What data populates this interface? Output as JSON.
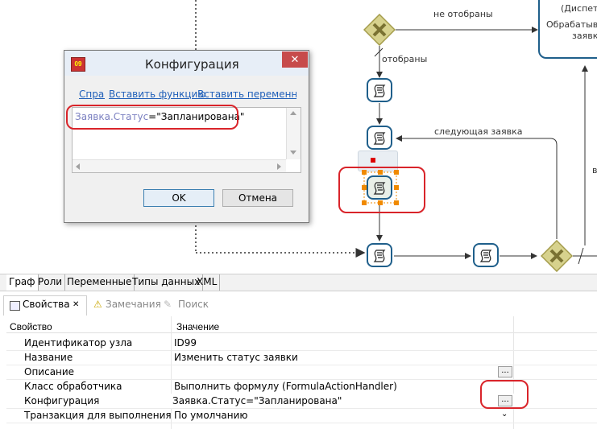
{
  "canvas": {
    "labels": {
      "not_selected": "не отобраны",
      "selected": "отобраны",
      "next_request": "следующая заявка",
      "dispatcher_partial": "(Диспет",
      "process_partial": "Обрабатыв",
      "requests_partial": "заявк"
    }
  },
  "dialog": {
    "title": "Конфигурация",
    "close": "✕",
    "links": {
      "help": "Справка",
      "insert_function": "Вставить функцию",
      "insert_variable": "Вставить переменную"
    },
    "editor": {
      "object": "Заявка.Статус",
      "operator": "=",
      "literal": "\"Запланирована\""
    },
    "ok": "OK",
    "cancel": "Отмена"
  },
  "editor_tabs": [
    "Граф",
    "Роли",
    "Переменные",
    "Типы данных",
    "XML"
  ],
  "properties_view": {
    "tabs": [
      "Свойства",
      "Замечания",
      "Поиск"
    ],
    "tab_close": "✕",
    "header": {
      "property": "Свойство",
      "value": "Значение"
    },
    "rows": [
      {
        "key": "Идентификатор узла",
        "value": "ID99"
      },
      {
        "key": "Название",
        "value": "Изменить статус заявки"
      },
      {
        "key": "Описание",
        "value": ""
      },
      {
        "key": "Класс обработчика",
        "value": "Выполнить формулу (FormulaActionHandler)"
      },
      {
        "key": "Конфигурация",
        "value": "Заявка.Статус=\"Запланирована\""
      },
      {
        "key": "Транзакция для выполнения",
        "value": "По умолчанию"
      }
    ],
    "ellipsis": "..."
  },
  "colors": {
    "task_stroke": "#1f5f8b",
    "gateway_fill": "#d7d28d",
    "highlight": "#d9242a",
    "link": "#1f5fb9"
  }
}
